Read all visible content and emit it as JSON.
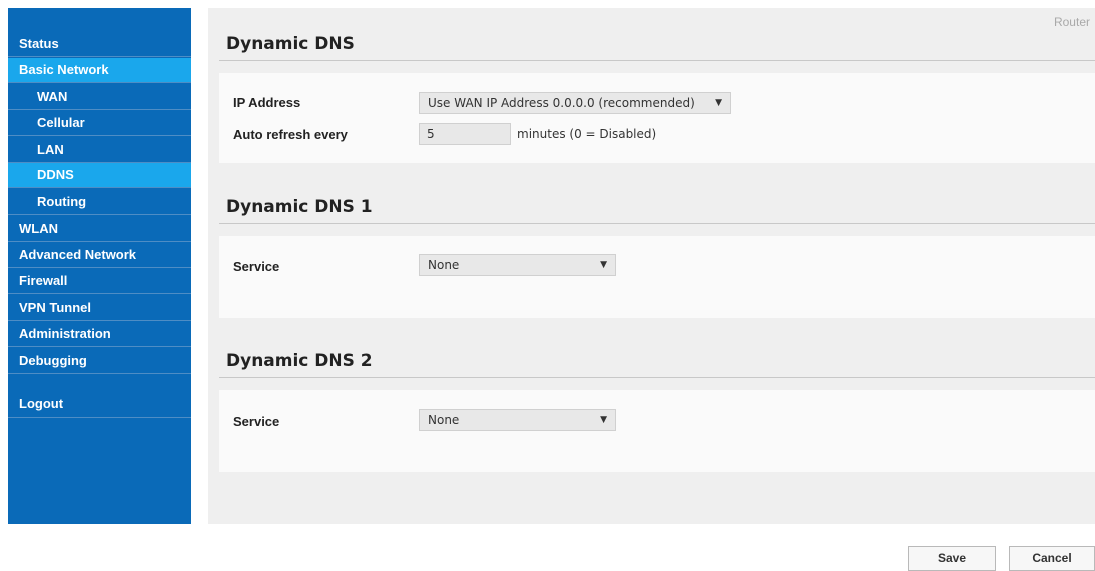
{
  "sidebar": {
    "items": [
      {
        "label": "Status"
      },
      {
        "label": "Basic Network"
      },
      {
        "label": "WAN"
      },
      {
        "label": "Cellular"
      },
      {
        "label": "LAN"
      },
      {
        "label": "DDNS"
      },
      {
        "label": "Routing"
      },
      {
        "label": "WLAN"
      },
      {
        "label": "Advanced Network"
      },
      {
        "label": "Firewall"
      },
      {
        "label": "VPN Tunnel"
      },
      {
        "label": "Administration"
      },
      {
        "label": "Debugging"
      },
      {
        "label": "Logout"
      }
    ]
  },
  "header": {
    "device_label": "Router"
  },
  "ddns": {
    "title": "Dynamic DNS",
    "ip_address_label": "IP Address",
    "ip_address_value": "Use WAN IP Address 0.0.0.0 (recommended)",
    "auto_refresh_label": "Auto refresh every",
    "auto_refresh_value": "5",
    "auto_refresh_hint": "minutes (0 = Disabled)"
  },
  "ddns1": {
    "title": "Dynamic DNS 1",
    "service_label": "Service",
    "service_value": "None"
  },
  "ddns2": {
    "title": "Dynamic DNS 2",
    "service_label": "Service",
    "service_value": "None"
  },
  "actions": {
    "save_label": "Save",
    "cancel_label": "Cancel"
  },
  "colors": {
    "sidebar_bg": "#0a6ab8",
    "active_item": "#1aa7ec",
    "panel_bg": "#efefef"
  }
}
